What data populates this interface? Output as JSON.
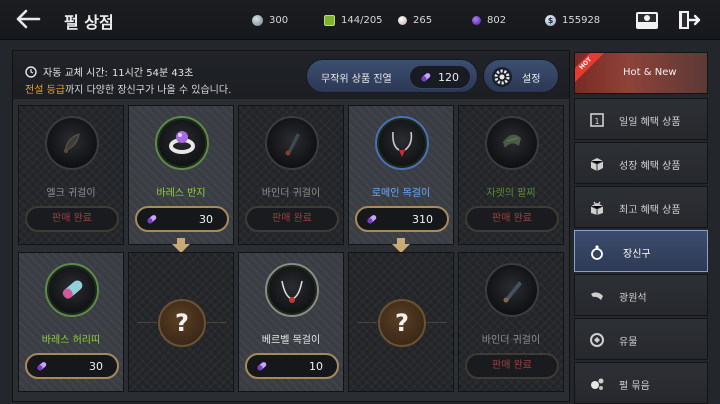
{
  "header": {
    "title": "펄 상점",
    "resources": [
      {
        "icon": "silver-orb-icon",
        "value": "300",
        "color": "#9fb3b8"
      },
      {
        "icon": "energy-icon",
        "value": "144/205",
        "color": "#8fc23a"
      },
      {
        "icon": "pearl-icon",
        "value": "265",
        "color": "#e8d8cf"
      },
      {
        "icon": "purple-gem-icon",
        "value": "802",
        "color": "#7a3cc8"
      },
      {
        "icon": "silver-coin-icon",
        "value": "155928",
        "color": "#bcd0e6"
      }
    ]
  },
  "info": {
    "timer_label": "자동 교체 시간:",
    "timer_value": "11시간 54분 43초",
    "notice_highlight": "전설 등급",
    "notice_rest": "까지 다양한 장신구가 나올 수 있습니다."
  },
  "shuffle": {
    "label": "무작위 상품 진열",
    "cost": "120"
  },
  "settings": {
    "label": "설정"
  },
  "cards": [
    {
      "name": "엘크 귀걸이",
      "status": "판매 완료",
      "state": "sold"
    },
    {
      "name": "바레스 반지",
      "price": "30",
      "state": "available"
    },
    {
      "name": "바인더 귀걸이",
      "status": "판매 완료",
      "state": "sold"
    },
    {
      "name": "로메인 목걸이",
      "price": "310",
      "state": "available"
    },
    {
      "name": "자렛의 팔찌",
      "status": "판매 완료",
      "state": "sold"
    },
    {
      "name": "바레스 허리띠",
      "price": "30",
      "state": "available"
    },
    {
      "name": "?",
      "state": "mystery"
    },
    {
      "name": "베르벨 목걸이",
      "price": "10",
      "state": "available"
    },
    {
      "name": "?",
      "state": "mystery"
    },
    {
      "name": "바인더 귀걸이",
      "status": "판매 완료",
      "state": "sold"
    }
  ],
  "sidebar": {
    "items": [
      {
        "label": "Hot & New",
        "icon": "hot-new-icon",
        "badge": "HOT"
      },
      {
        "label": "일일 혜택 상품",
        "icon": "calendar-icon"
      },
      {
        "label": "성장 혜택 상품",
        "icon": "box-icon"
      },
      {
        "label": "최고 혜택 상품",
        "icon": "crate-icon"
      },
      {
        "label": "장신구",
        "icon": "ring-icon",
        "active": true
      },
      {
        "label": "광원석",
        "icon": "ore-icon"
      },
      {
        "label": "유물",
        "icon": "relic-icon"
      },
      {
        "label": "펄 묶음",
        "icon": "pearls-icon"
      }
    ]
  }
}
